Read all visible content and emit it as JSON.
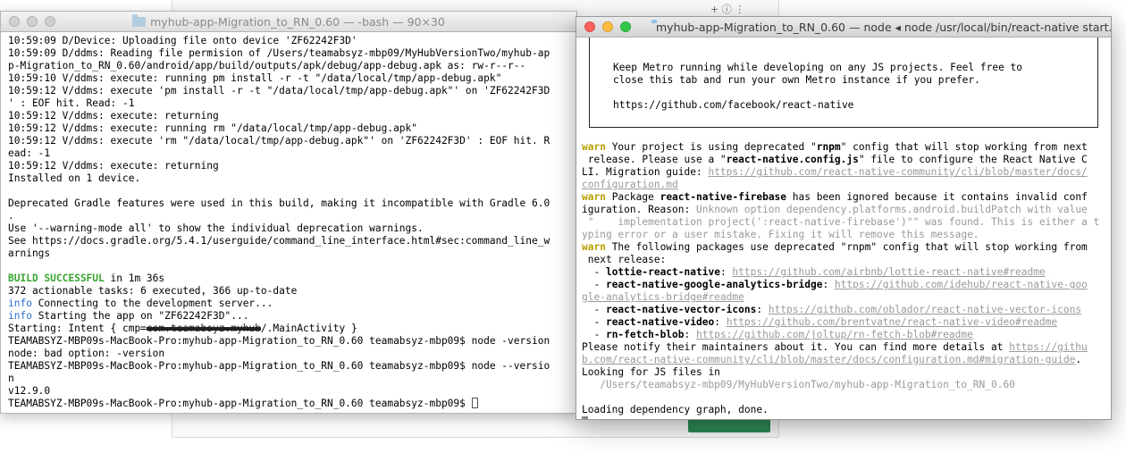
{
  "background": {
    "ext_text": "+ ⓘ ⋮"
  },
  "left_terminal": {
    "title": "myhub-app-Migration_to_RN_0.60 — -bash — 90×30",
    "lines": [
      [
        {
          "t": "10:59:09 D/Device: Uploading file onto device 'ZF62242F3D'"
        }
      ],
      [
        {
          "t": "10:59:09 D/ddms: Reading file permision of /Users/teamabsyz-mbp09/MyHubVersionTwo/myhub-ap"
        }
      ],
      [
        {
          "t": "p-Migration_to_RN_0.60/android/app/build/outputs/apk/debug/app-debug.apk as: rw-r--r--"
        }
      ],
      [
        {
          "t": "10:59:10 V/ddms: execute: running pm install -r -t \"/data/local/tmp/app-debug.apk\""
        }
      ],
      [
        {
          "t": "10:59:12 V/ddms: execute 'pm install -r -t \"/data/local/tmp/app-debug.apk\"' on 'ZF62242F3D"
        }
      ],
      [
        {
          "t": "' : EOF hit. Read: -1"
        }
      ],
      [
        {
          "t": "10:59:12 V/ddms: execute: returning"
        }
      ],
      [
        {
          "t": "10:59:12 V/ddms: execute: running rm \"/data/local/tmp/app-debug.apk\""
        }
      ],
      [
        {
          "t": "10:59:12 V/ddms: execute 'rm \"/data/local/tmp/app-debug.apk\"' on 'ZF62242F3D' : EOF hit. R"
        }
      ],
      [
        {
          "t": "ead: -1"
        }
      ],
      [
        {
          "t": "10:59:12 V/ddms: execute: returning"
        }
      ],
      [
        {
          "t": "Installed on 1 device."
        }
      ],
      [
        {
          "t": ""
        }
      ],
      [
        {
          "t": "Deprecated Gradle features were used in this build, making it incompatible with Gradle 6.0"
        }
      ],
      [
        {
          "t": "."
        }
      ],
      [
        {
          "t": "Use '--warning-mode all' to show the individual deprecation warnings."
        }
      ],
      [
        {
          "t": "See https://docs.gradle.org/5.4.1/userguide/command_line_interface.html#sec:command_line_w"
        }
      ],
      [
        {
          "t": "arnings"
        }
      ],
      [
        {
          "t": ""
        }
      ],
      [
        {
          "t": "BUILD SUCCESSFUL",
          "c": "grn"
        },
        {
          "t": " in 1m 36s"
        }
      ],
      [
        {
          "t": "372 actionable tasks: 6 executed, 366 up-to-date"
        }
      ],
      [
        {
          "t": "info",
          "c": "blu"
        },
        {
          "t": " Connecting to the development server..."
        }
      ],
      [
        {
          "t": "info",
          "c": "blu"
        },
        {
          "t": " Starting the app on \"ZF62242F3D\"..."
        }
      ],
      [
        {
          "t": "Starting: Intent { cmp="
        },
        {
          "t": "com.teamabsyz.myhub",
          "c": "scribble"
        },
        {
          "t": "/.MainActivity }"
        }
      ],
      [
        {
          "t": "TEAMABSYZ-MBP09s-MacBook-Pro:myhub-app-Migration_to_RN_0.60 teamabsyz-mbp09$ node -version"
        }
      ],
      [
        {
          "t": "node: bad option: -version"
        }
      ],
      [
        {
          "t": "TEAMABSYZ-MBP09s-MacBook-Pro:myhub-app-Migration_to_RN_0.60 teamabsyz-mbp09$ node --versio"
        }
      ],
      [
        {
          "t": "n"
        }
      ],
      [
        {
          "t": "v12.9.0"
        }
      ],
      [
        {
          "t": "TEAMABSYZ-MBP09s-MacBook-Pro:myhub-app-Migration_to_RN_0.60 teamabsyz-mbp09$ "
        }
      ]
    ]
  },
  "right_terminal": {
    "title": "myhub-app-Migration_to_RN_0.60 — node ◂ node /usr/local/bin/react-native start...",
    "box_lines": [
      [
        {
          "t": "Keep Metro running while developing on any JS projects. Feel free to"
        }
      ],
      [
        {
          "t": "close this tab and run your own Metro instance if you prefer."
        }
      ],
      [
        {
          "t": ""
        }
      ],
      [
        {
          "t": "https://github.com/facebook/react-native"
        }
      ]
    ],
    "lines": [
      [
        {
          "t": ""
        }
      ],
      [
        {
          "t": "warn",
          "c": "warn"
        },
        {
          "t": " Your project is using deprecated \""
        },
        {
          "t": "rnpm",
          "c": "b"
        },
        {
          "t": "\" config that will stop working from next"
        }
      ],
      [
        {
          "t": " release. Please use a \""
        },
        {
          "t": "react-native.config.js",
          "c": "b"
        },
        {
          "t": "\" file to configure the React Native C"
        }
      ],
      [
        {
          "t": "LI. Migration guide: "
        },
        {
          "t": "https://github.com/react-native-community/cli/blob/master/docs/",
          "c": "link"
        }
      ],
      [
        {
          "t": "configuration.md",
          "c": "link"
        }
      ],
      [
        {
          "t": "warn",
          "c": "warn"
        },
        {
          "t": " Package "
        },
        {
          "t": "react-native-firebase",
          "c": "b"
        },
        {
          "t": " has been ignored because it contains invalid conf"
        }
      ],
      [
        {
          "t": "iguration. Reason: "
        },
        {
          "t": "Unknown option dependency.platforms.android.buildPatch with value",
          "c": "gray"
        }
      ],
      [
        {
          "t": " \"    implementation project(':react-native-firebase')\"\" was found. This is either a t",
          "c": "gray"
        }
      ],
      [
        {
          "t": "yping error or a user mistake. Fixing it will remove this message.",
          "c": "gray"
        }
      ],
      [
        {
          "t": "warn",
          "c": "warn"
        },
        {
          "t": " The following packages use deprecated \"rnpm\" config that will stop working from"
        }
      ],
      [
        {
          "t": " next release:"
        }
      ],
      [
        {
          "t": "  - "
        },
        {
          "t": "lottie-react-native",
          "c": "b"
        },
        {
          "t": ": "
        },
        {
          "t": "https://github.com/airbnb/lottie-react-native#readme",
          "c": "link"
        }
      ],
      [
        {
          "t": "  - "
        },
        {
          "t": "react-native-google-analytics-bridge",
          "c": "b"
        },
        {
          "t": ": "
        },
        {
          "t": "https://github.com/idehub/react-native-goo",
          "c": "link"
        }
      ],
      [
        {
          "t": "gle-analytics-bridge#readme",
          "c": "link"
        }
      ],
      [
        {
          "t": "  - "
        },
        {
          "t": "react-native-vector-icons",
          "c": "b"
        },
        {
          "t": ": "
        },
        {
          "t": "https://github.com/oblador/react-native-vector-icons",
          "c": "link"
        }
      ],
      [
        {
          "t": "  - "
        },
        {
          "t": "react-native-video",
          "c": "b"
        },
        {
          "t": ": "
        },
        {
          "t": "https://github.com/brentvatne/react-native-video#readme",
          "c": "link"
        }
      ],
      [
        {
          "t": "  - "
        },
        {
          "t": "rn-fetch-blob",
          "c": "b"
        },
        {
          "t": ": "
        },
        {
          "t": "https://github.com/joltup/rn-fetch-blob#readme",
          "c": "link"
        }
      ],
      [
        {
          "t": "Please notify their maintainers about it. You can find more details at "
        },
        {
          "t": "https://githu",
          "c": "link"
        }
      ],
      [
        {
          "t": "b.com/react-native-community/cli/blob/master/docs/configuration.md#migration-guide",
          "c": "link"
        },
        {
          "t": "."
        }
      ],
      [
        {
          "t": "Looking for JS files in"
        }
      ],
      [
        {
          "t": "   /Users/teamabsyz-mbp09/MyHubVersionTwo/myhub-app-Migration_to_RN_0.60",
          "c": "gray"
        }
      ],
      [
        {
          "t": ""
        }
      ],
      [
        {
          "t": "Loading dependency graph, done."
        }
      ]
    ]
  }
}
